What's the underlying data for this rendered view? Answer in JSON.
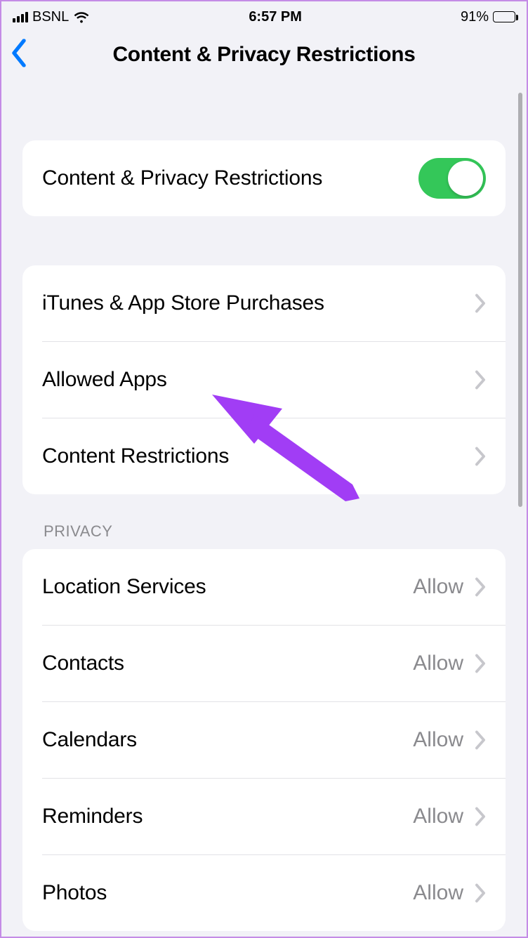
{
  "status": {
    "carrier": "BSNL",
    "time": "6:57 PM",
    "battery_pct": "91%",
    "battery_fill_pct": 91
  },
  "header": {
    "title": "Content & Privacy Restrictions"
  },
  "toggle_group": {
    "label": "Content & Privacy Restrictions",
    "enabled": true
  },
  "nav_group": {
    "items": [
      {
        "label": "iTunes & App Store Purchases"
      },
      {
        "label": "Allowed Apps"
      },
      {
        "label": "Content Restrictions"
      }
    ]
  },
  "privacy_section": {
    "header": "PRIVACY",
    "items": [
      {
        "label": "Location Services",
        "value": "Allow"
      },
      {
        "label": "Contacts",
        "value": "Allow"
      },
      {
        "label": "Calendars",
        "value": "Allow"
      },
      {
        "label": "Reminders",
        "value": "Allow"
      },
      {
        "label": "Photos",
        "value": "Allow"
      }
    ]
  },
  "annotation": {
    "arrow_color": "#a13df5"
  }
}
